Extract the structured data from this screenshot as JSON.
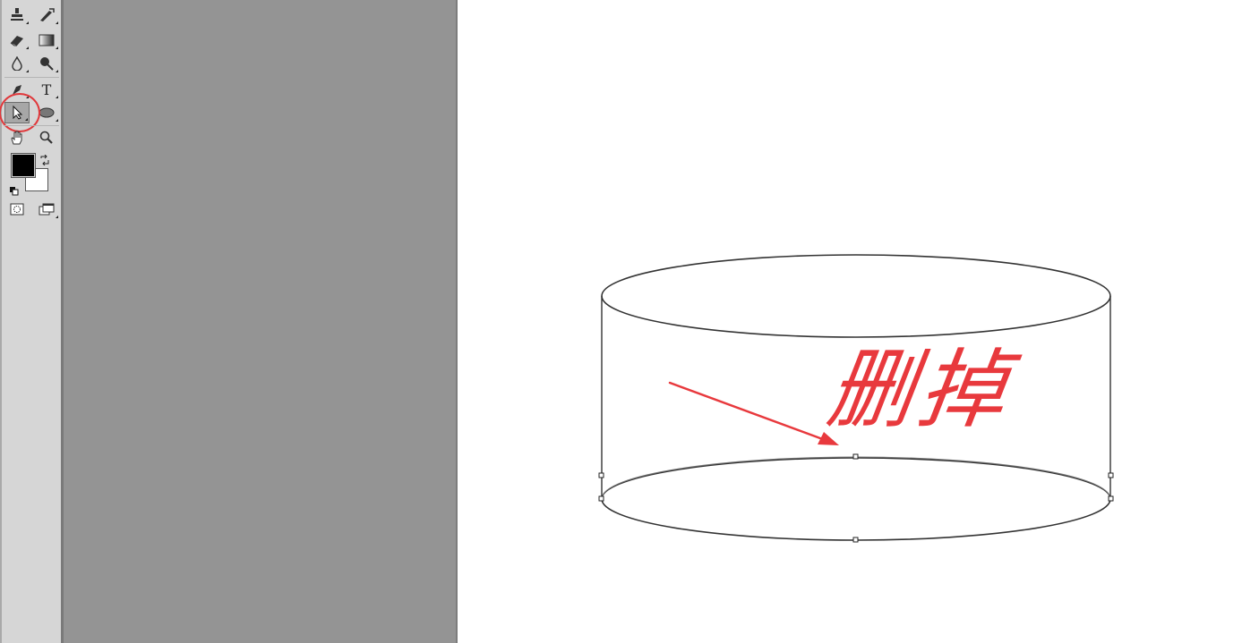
{
  "toolbox": {
    "tools": [
      {
        "id": "stamp",
        "icon": "clone-stamp-icon"
      },
      {
        "id": "history-brush",
        "icon": "history-brush-icon"
      },
      {
        "id": "eraser",
        "icon": "eraser-icon"
      },
      {
        "id": "gradient",
        "icon": "gradient-icon"
      },
      {
        "id": "blur",
        "icon": "blur-drop-icon"
      },
      {
        "id": "dodge",
        "icon": "dodge-icon"
      },
      {
        "id": "pen",
        "icon": "pen-icon"
      },
      {
        "id": "type",
        "icon": "type-icon",
        "glyph": "T"
      },
      {
        "id": "path-selection",
        "icon": "path-selection-arrow-icon",
        "active": true
      },
      {
        "id": "ellipse",
        "icon": "ellipse-shape-icon"
      },
      {
        "id": "hand",
        "icon": "hand-icon"
      },
      {
        "id": "zoom",
        "icon": "zoom-icon"
      },
      {
        "id": "quick-mask",
        "icon": "quick-mask-icon"
      },
      {
        "id": "screen-mode",
        "icon": "screen-mode-icon"
      }
    ],
    "foreground_color": "#000000",
    "background_color": "#ffffff"
  },
  "annotation": {
    "text": "删掉",
    "color": "#e8393d"
  },
  "colors": {
    "pasteboard": "#949494",
    "canvas": "#ffffff",
    "stroke": "#333333"
  }
}
